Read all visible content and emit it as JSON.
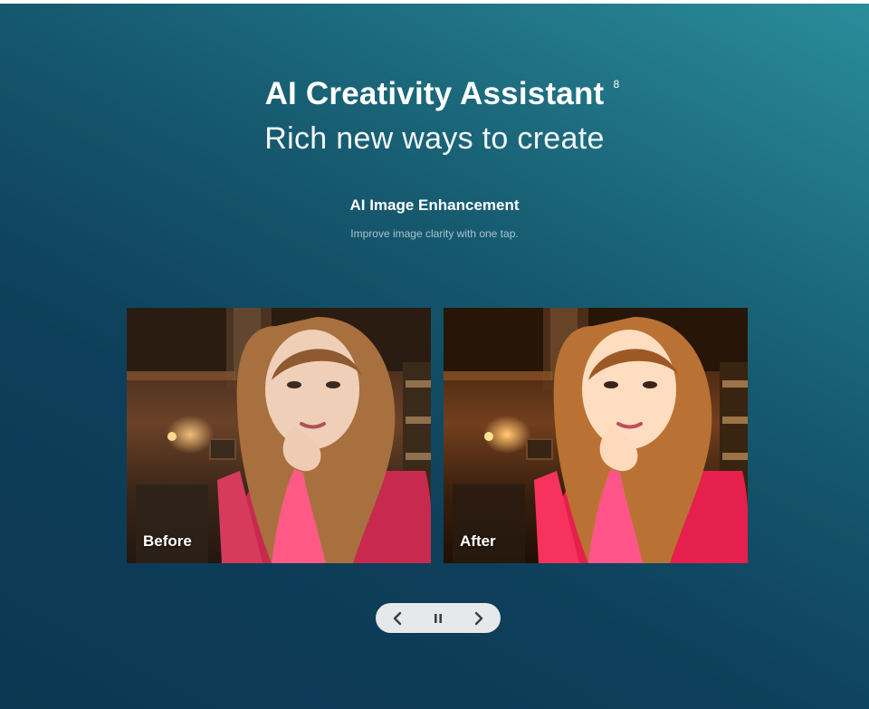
{
  "header": {
    "title": "AI Creativity Assistant",
    "footnote": "8",
    "subtitle": "Rich new ways to create"
  },
  "feature": {
    "title": "AI Image Enhancement",
    "description": "Improve image clarity with one tap."
  },
  "comparison": {
    "before_label": "Before",
    "after_label": "After"
  },
  "carousel": {
    "prev_icon": "chevron-left-icon",
    "pause_icon": "pause-icon",
    "next_icon": "chevron-right-icon"
  },
  "colors": {
    "background_light": "#2a8c9a",
    "background_dark": "#0c3752",
    "control_bg": "#e7e8ec",
    "control_icon": "#3a3d44"
  }
}
